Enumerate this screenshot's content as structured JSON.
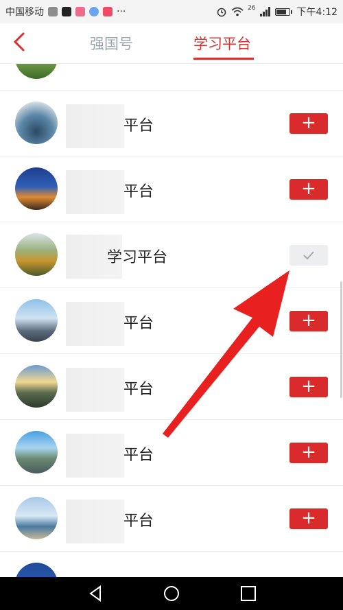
{
  "status_bar": {
    "carrier": "中国移动",
    "dots": "···",
    "network": "26",
    "time": "下午4:12",
    "battery_level": 0.85,
    "icons": [
      "alarm-icon",
      "wifi-icon",
      "signal-icon",
      "battery-icon"
    ]
  },
  "header": {
    "tabs": [
      {
        "label": "强国号",
        "active": false
      },
      {
        "label": "学习平台",
        "active": true
      }
    ],
    "accent_color": "#d92f2f"
  },
  "list": {
    "items": [
      {
        "name": "平台",
        "state": "add"
      },
      {
        "name": "平台",
        "state": "add"
      },
      {
        "name": "学习平台",
        "state": "subscribed"
      },
      {
        "name": "平台",
        "state": "add"
      },
      {
        "name": "平台",
        "state": "add"
      },
      {
        "name": "平台",
        "state": "add"
      },
      {
        "name": "平台",
        "state": "add"
      }
    ],
    "add_label": "+",
    "check_label": "✓"
  },
  "annotation": {
    "color": "#e82020",
    "shape": "arrow"
  },
  "system_nav": {
    "icons": [
      "back-icon",
      "home-icon",
      "recents-icon"
    ]
  }
}
